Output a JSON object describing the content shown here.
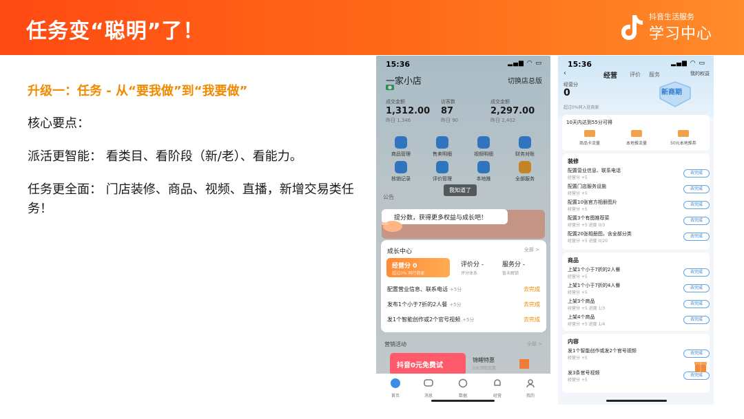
{
  "banner": {
    "title": "任务变“聪明”了！",
    "brand_sub": "抖音生活服务",
    "brand_main": "学习中心"
  },
  "slide": {
    "heading": "升级一：任务 - 从“要我做”到“我要做”",
    "points_label": "核心要点：",
    "point1": "派活更智能：  看类目、看阶段（新/老）、看能力。",
    "point2": "任务更全面：  门店装修、商品、视频、直播，新增交易类任务！"
  },
  "phone1": {
    "time": "15:36",
    "store_name": "一家小店",
    "switch_label": "切换店总版",
    "stats": [
      {
        "label": "成交金额",
        "value": "1,312.00",
        "sub": "昨日 1,346"
      },
      {
        "label": "访客数",
        "value": "87",
        "sub": "昨日 90"
      },
      {
        "label": "成交金额",
        "value": "2,297.00",
        "sub": "昨日 2,402"
      }
    ],
    "grid": [
      {
        "label": "商品管理",
        "color": "#3a8ee6"
      },
      {
        "label": "售卖明细",
        "color": "#3a8ee6"
      },
      {
        "label": "视频明细",
        "color": "#3a8ee6"
      },
      {
        "label": "财务对账",
        "color": "#3a8ee6"
      },
      {
        "label": "核销记录",
        "color": "#3a8ee6"
      },
      {
        "label": "评价管理",
        "color": "#3a8ee6"
      },
      {
        "label": "本地推",
        "color": "#3a8ee6"
      },
      {
        "label": "全部服务",
        "color": "#f0a030"
      }
    ],
    "notice": "公告",
    "got_it": "我知道了",
    "tooltip": "提分数，获得更多权益与成长吧！",
    "growth": {
      "title": "成长中心",
      "all": "全部 >",
      "tab_active": "经营分 0",
      "tab_active_sub": "超过0% 同行商家",
      "tab2": "评价分 -",
      "tab2_sub": "评分体系",
      "tab3": "服务分 -",
      "tab3_sub": "暂未解锁",
      "tasks": [
        {
          "name": "配置营业信息、联系电话",
          "pts": "+5分",
          "go": "去完成"
        },
        {
          "name": "发布1个小于7折的2人餐",
          "pts": "+5分",
          "go": "去完成"
        },
        {
          "name": "发1个智能创作或2个官号视频",
          "pts": "+5分",
          "go": "去完成"
        }
      ]
    },
    "promo": {
      "title": "营销活动",
      "all": "全部 >",
      "card": "抖音0元免费试",
      "side": "锦鲤特惠",
      "side_sub": "0元领取优惠"
    },
    "tabbar": [
      "首页",
      "消息",
      "数据",
      "经营",
      "我的"
    ]
  },
  "phone2": {
    "time": "15:36",
    "nav": {
      "active": "经营",
      "tab2": "评价",
      "tab3": "服务",
      "rights": "我的权益"
    },
    "score_label": "经营分",
    "score": "0",
    "score_sub": "超过0%同入驻商家",
    "stage": "新商期",
    "reward_title": "10天内达到55分可得",
    "rewards": [
      "商品卡流量",
      "本地推流量",
      "50元本地推券"
    ],
    "sections": [
      {
        "title": "装修",
        "tasks": [
          {
            "name": "配置营业信息、联系电话",
            "sub": "经营分 +5",
            "btn": "去完成"
          },
          {
            "name": "配置门店服务设施",
            "sub": "经营分 +5",
            "btn": "去完成"
          },
          {
            "name": "配置10张官方相册图片",
            "sub": "经营分 +5",
            "btn": "去完成"
          },
          {
            "name": "配置3个有图推荐菜",
            "sub": "经营分 +5  进度 0/3",
            "btn": "去完成"
          },
          {
            "name": "配置20张相册图，含全部分类",
            "sub": "经营分 +5  进度 0/20",
            "btn": "去完成"
          }
        ]
      },
      {
        "title": "商品",
        "tasks": [
          {
            "name": "上架1个小于7折的2人餐",
            "sub": "经营分 +5",
            "btn": "去完成"
          },
          {
            "name": "上架1个小于7折的4人餐",
            "sub": "经营分 +5",
            "btn": "去完成"
          },
          {
            "name": "上架3个商品",
            "sub": "经营分 +5  进度 1/3",
            "btn": "去完成"
          },
          {
            "name": "上架4个商品",
            "sub": "经营分 +5  进度 1/4",
            "btn": "去完成"
          }
        ]
      },
      {
        "title": "内容",
        "tasks": [
          {
            "name": "发1个智能创作或发2个官号视频",
            "sub": "经营分 +5",
            "btn": "去完成"
          },
          {
            "name": "发3条官号视频",
            "sub": "经营分 +5",
            "btn": "去完成"
          }
        ]
      }
    ]
  }
}
